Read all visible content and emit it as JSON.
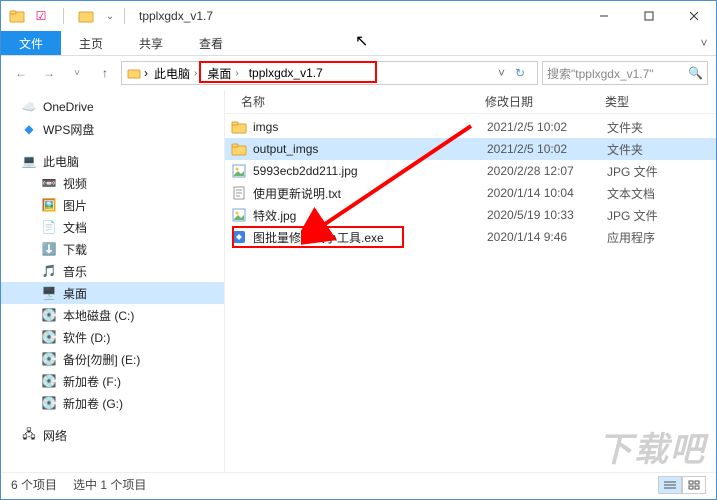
{
  "window": {
    "title": "tpplxgdx_v1.7"
  },
  "ribbon": {
    "file": "文件",
    "home": "主页",
    "share": "共享",
    "view": "查看"
  },
  "breadcrumb": {
    "this_pc": "此电脑",
    "desktop": "桌面",
    "folder": "tpplxgdx_v1.7"
  },
  "search": {
    "placeholder": "搜索\"tpplxgdx_v1.7\""
  },
  "sidebar": {
    "onedrive": "OneDrive",
    "wps": "WPS网盘",
    "this_pc": "此电脑",
    "video": "视频",
    "pictures": "图片",
    "documents": "文档",
    "downloads": "下载",
    "music": "音乐",
    "desktop": "桌面",
    "disk_c": "本地磁盘 (C:)",
    "disk_d": "软件 (D:)",
    "disk_e": "备份[勿删] (E:)",
    "disk_f": "新加卷 (F:)",
    "disk_g": "新加卷 (G:)",
    "network": "网络"
  },
  "columns": {
    "name": "名称",
    "date": "修改日期",
    "type": "类型"
  },
  "files": [
    {
      "name": "imgs",
      "date": "2021/2/5 10:02",
      "type": "文件夹",
      "kind": "folder"
    },
    {
      "name": "output_imgs",
      "date": "2021/2/5 10:02",
      "type": "文件夹",
      "kind": "folder",
      "selected": true
    },
    {
      "name": "5993ecb2dd211.jpg",
      "date": "2020/2/28 12:07",
      "type": "JPG 文件",
      "kind": "jpg"
    },
    {
      "name": "使用更新说明.txt",
      "date": "2020/1/14 10:04",
      "type": "文本文档",
      "kind": "txt"
    },
    {
      "name": "特效.jpg",
      "date": "2020/5/19 10:33",
      "type": "JPG 文件",
      "kind": "jpg"
    },
    {
      "name": "图批量修改大小工具.exe",
      "date": "2020/1/14 9:46",
      "type": "应用程序",
      "kind": "exe"
    }
  ],
  "status": {
    "count": "6 个项目",
    "selected": "选中 1 个项目"
  },
  "watermark": "下载吧"
}
